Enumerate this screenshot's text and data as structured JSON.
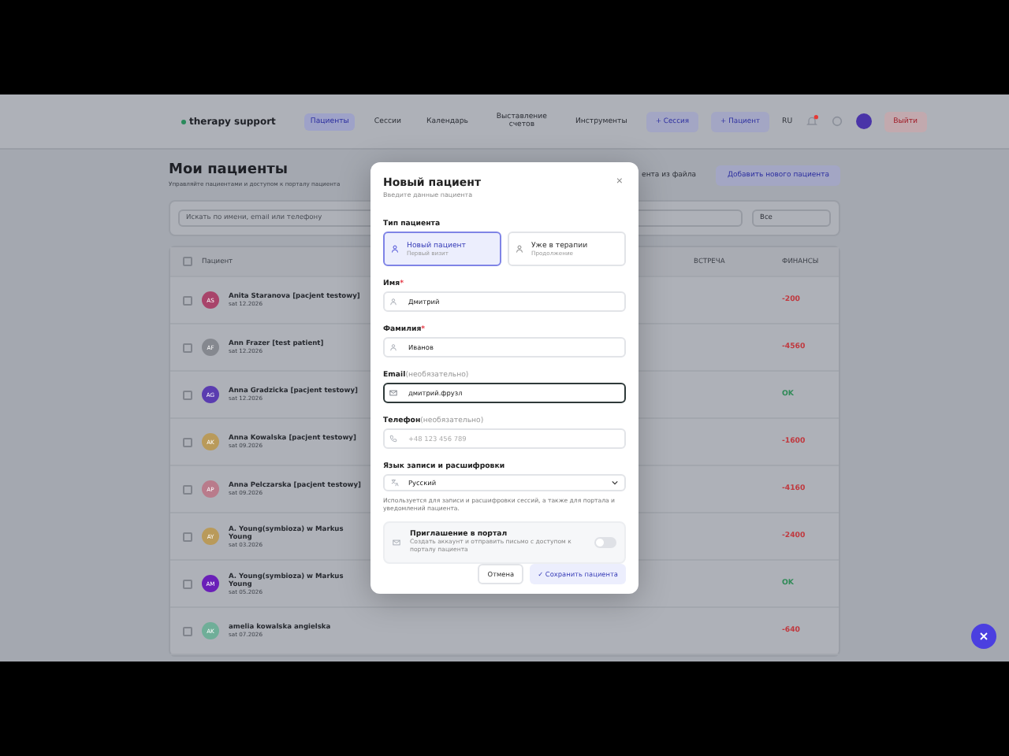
{
  "nav": {
    "logo": "therapy support",
    "links": [
      {
        "label": "Пациенты",
        "selected": true
      },
      {
        "label": "Сессии",
        "selected": false
      },
      {
        "label": "Календарь",
        "selected": false
      },
      {
        "label": "Выставление счетов",
        "selected": false
      },
      {
        "label": "Инструменты",
        "selected": false
      }
    ],
    "actions": [
      "+ Сессия",
      "+ Пациент"
    ],
    "language": "RU",
    "logout": "Выйти"
  },
  "page": {
    "title": "Мои пациенты",
    "subtitle": "Управляйте пациентами и доступом к порталу пациента",
    "import_button": "ента из файла",
    "add_button": "Добавить нового пациента",
    "search_placeholder": "Искать по имени, email или телефону",
    "filter": "Все"
  },
  "table": {
    "all_checked": false,
    "columns": [
      "Пациент",
      "ВСТРЕЧА",
      "ФИНАНСЫ"
    ],
    "rows": [
      {
        "checked": false,
        "initials": "AS",
        "color": "#a8446a",
        "name": "Anita Staranova [pacjent testowy]",
        "date": "sat 12.2026",
        "finance": {
          "text": "-200",
          "color": "#c0393f"
        }
      },
      {
        "checked": false,
        "initials": "AF",
        "color": "#85888f",
        "name": "Ann Frazer [test patient]",
        "date": "sat 12.2026",
        "finance": {
          "text": "-4560",
          "color": "#c0393f"
        }
      },
      {
        "checked": false,
        "initials": "AG",
        "color": "#5a3cb0",
        "name": "Anna Gradzicka [pacjent testowy]",
        "date": "sat 12.2026",
        "finance": {
          "text": "OK",
          "color": "#2f8a57"
        }
      },
      {
        "checked": false,
        "initials": "AK",
        "color": "#b99a5a",
        "name": "Anna Kowalska [pacjent testowy]",
        "date": "sat 09.2026",
        "finance": {
          "text": "-1600",
          "color": "#c0393f"
        }
      },
      {
        "checked": false,
        "initials": "AP",
        "color": "#b97b8b",
        "name": "Anna Pelczarska [pacjent testowy]",
        "date": "sat 09.2026",
        "finance": {
          "text": "-4160",
          "color": "#c0393f"
        }
      },
      {
        "checked": false,
        "initials": "AY",
        "color": "#b99a5a",
        "name": "A. Young(symbioza) w Markus Young",
        "date": "sat 03.2026",
        "finance": {
          "text": "-2400",
          "color": "#c0393f"
        }
      },
      {
        "checked": false,
        "initials": "AM",
        "color": "#6a1fb8",
        "name": "A. Young(symbioza) w Markus Young",
        "date": "sat 05.2026",
        "finance": {
          "text": "OK",
          "color": "#2f8a57"
        }
      },
      {
        "checked": false,
        "initials": "AK",
        "color": "#6fae98",
        "name": "amelia kowalska angielska",
        "date": "sat 07.2026",
        "finance": {
          "text": "-640",
          "color": "#c0393f"
        }
      }
    ]
  },
  "modal": {
    "title": "Новый пациент",
    "subtitle": "Введите данные пациента",
    "close": "×",
    "type_label": "Тип пациента",
    "types": [
      {
        "title": "Новый пациент",
        "caption": "Первый визит",
        "selected": true
      },
      {
        "title": "Уже в терапии",
        "caption": "Продолжение",
        "selected": false
      }
    ],
    "fields": [
      {
        "kind": "name",
        "label": "Имя",
        "marker": "*",
        "value": "Дмитрий",
        "focused": false
      },
      {
        "kind": "name",
        "label": "Фамилия",
        "marker": "*",
        "value": "Иванов",
        "focused": false
      },
      {
        "kind": "email",
        "label": "Email",
        "note": "(необязательно)",
        "value": "дмитрий.фрузл",
        "focused": true
      },
      {
        "kind": "phone",
        "label": "Телефон",
        "note": "(необязательно)",
        "placeholder": "+48 123 456 789",
        "focused": false
      }
    ],
    "language": {
      "label": "Язык записи и расшифровки",
      "value": "Русский",
      "hint": "Используется для записи и расшифровки сессий, а также для портала и уведомлений пациента."
    },
    "portal": {
      "title": "Приглашение в портал",
      "description": "Создать аккаунт и отправить письмо с доступом к порталу пациента",
      "on": false
    },
    "cancel": "Отмена",
    "save": "Сохранить пациента",
    "save_icon": "✓"
  }
}
